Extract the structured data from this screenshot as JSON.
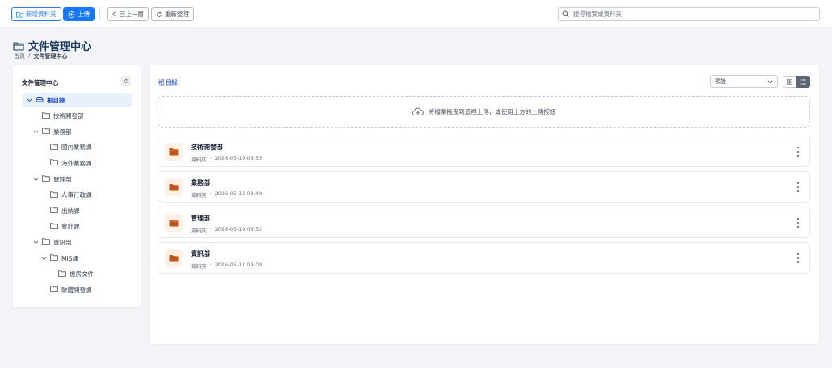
{
  "toolbar": {
    "new_folder": "新增資料夾",
    "upload": "上傳",
    "go_up": "回上一層",
    "refresh": "重新整理",
    "search_placeholder": "搜尋檔案或資料夾"
  },
  "page": {
    "title": "文件管理中心",
    "breadcrumb": [
      "首頁",
      "/",
      "文件管理中心"
    ]
  },
  "sidebar": {
    "title": "文件管理中心",
    "tree": [
      {
        "label": "根目錄",
        "level": 0,
        "expanded": true,
        "active": true,
        "icon": "drive-icon"
      },
      {
        "label": "技術開發部",
        "level": 1,
        "expanded": false,
        "icon": "folder-icon"
      },
      {
        "label": "業務部",
        "level": 1,
        "expanded": true,
        "icon": "folder-icon"
      },
      {
        "label": "國內業務課",
        "level": 2,
        "expanded": false,
        "icon": "folder-icon"
      },
      {
        "label": "海外業務課",
        "level": 2,
        "expanded": false,
        "icon": "folder-icon"
      },
      {
        "label": "管理部",
        "level": 1,
        "expanded": true,
        "icon": "folder-icon"
      },
      {
        "label": "人事行政課",
        "level": 2,
        "expanded": false,
        "icon": "folder-icon"
      },
      {
        "label": "出納課",
        "level": 2,
        "expanded": false,
        "icon": "folder-icon"
      },
      {
        "label": "會計課",
        "level": 2,
        "expanded": false,
        "icon": "folder-icon"
      },
      {
        "label": "資訊部",
        "level": 1,
        "expanded": true,
        "icon": "folder-icon"
      },
      {
        "label": "MIS課",
        "level": 2,
        "expanded": true,
        "icon": "folder-icon"
      },
      {
        "label": "機房文件",
        "level": 3,
        "expanded": false,
        "icon": "folder-icon"
      },
      {
        "label": "軟體開發課",
        "level": 2,
        "expanded": false,
        "icon": "folder-icon"
      }
    ]
  },
  "main": {
    "current_dir": "根目錄",
    "sort_value": "預設",
    "dropzone_text": "將檔案拖曳到這裡上傳，或使用上方的上傳按鈕",
    "items": [
      {
        "name": "技術開發部",
        "type": "資料夾",
        "date": "2026-05-19 06:35"
      },
      {
        "name": "業務部",
        "type": "資料夾",
        "date": "2026-05-12 08:49"
      },
      {
        "name": "管理部",
        "type": "資料夾",
        "date": "2026-05-19 06:32"
      },
      {
        "name": "資訊部",
        "type": "資料夾",
        "date": "2026-05-11 09:09"
      }
    ]
  },
  "colors": {
    "primary": "#1677ff",
    "folder": "#c0551a",
    "folder_bg": "#fdf1e6",
    "title": "#1e3a5f"
  }
}
